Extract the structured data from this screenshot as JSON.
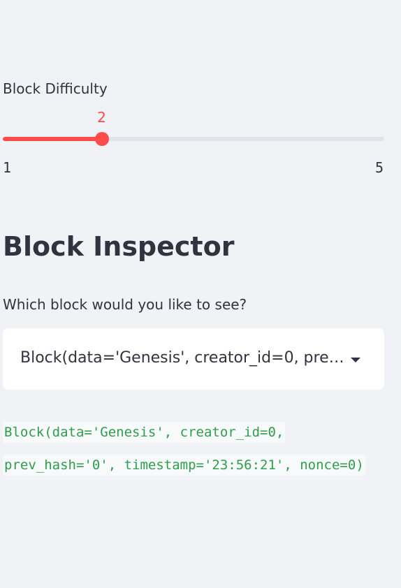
{
  "difficulty_slider": {
    "label": "Block Difficulty",
    "value": 2,
    "min": 1,
    "max": 5,
    "accent_color": "#ff4b4b"
  },
  "inspector": {
    "heading": "Block Inspector",
    "select_label": "Which block would you like to see?",
    "selected_option": "Block(data='Genesis', creator_id=0, prev_hash='0', timestamp='23:56:21', nonce=0)",
    "dropdown_icon": "chevron-down-icon",
    "code_text": "Block(data='Genesis', creator_id=0, prev_hash='0', timestamp='23:56:21', nonce=0)",
    "code_color": "#2e9e4a"
  }
}
